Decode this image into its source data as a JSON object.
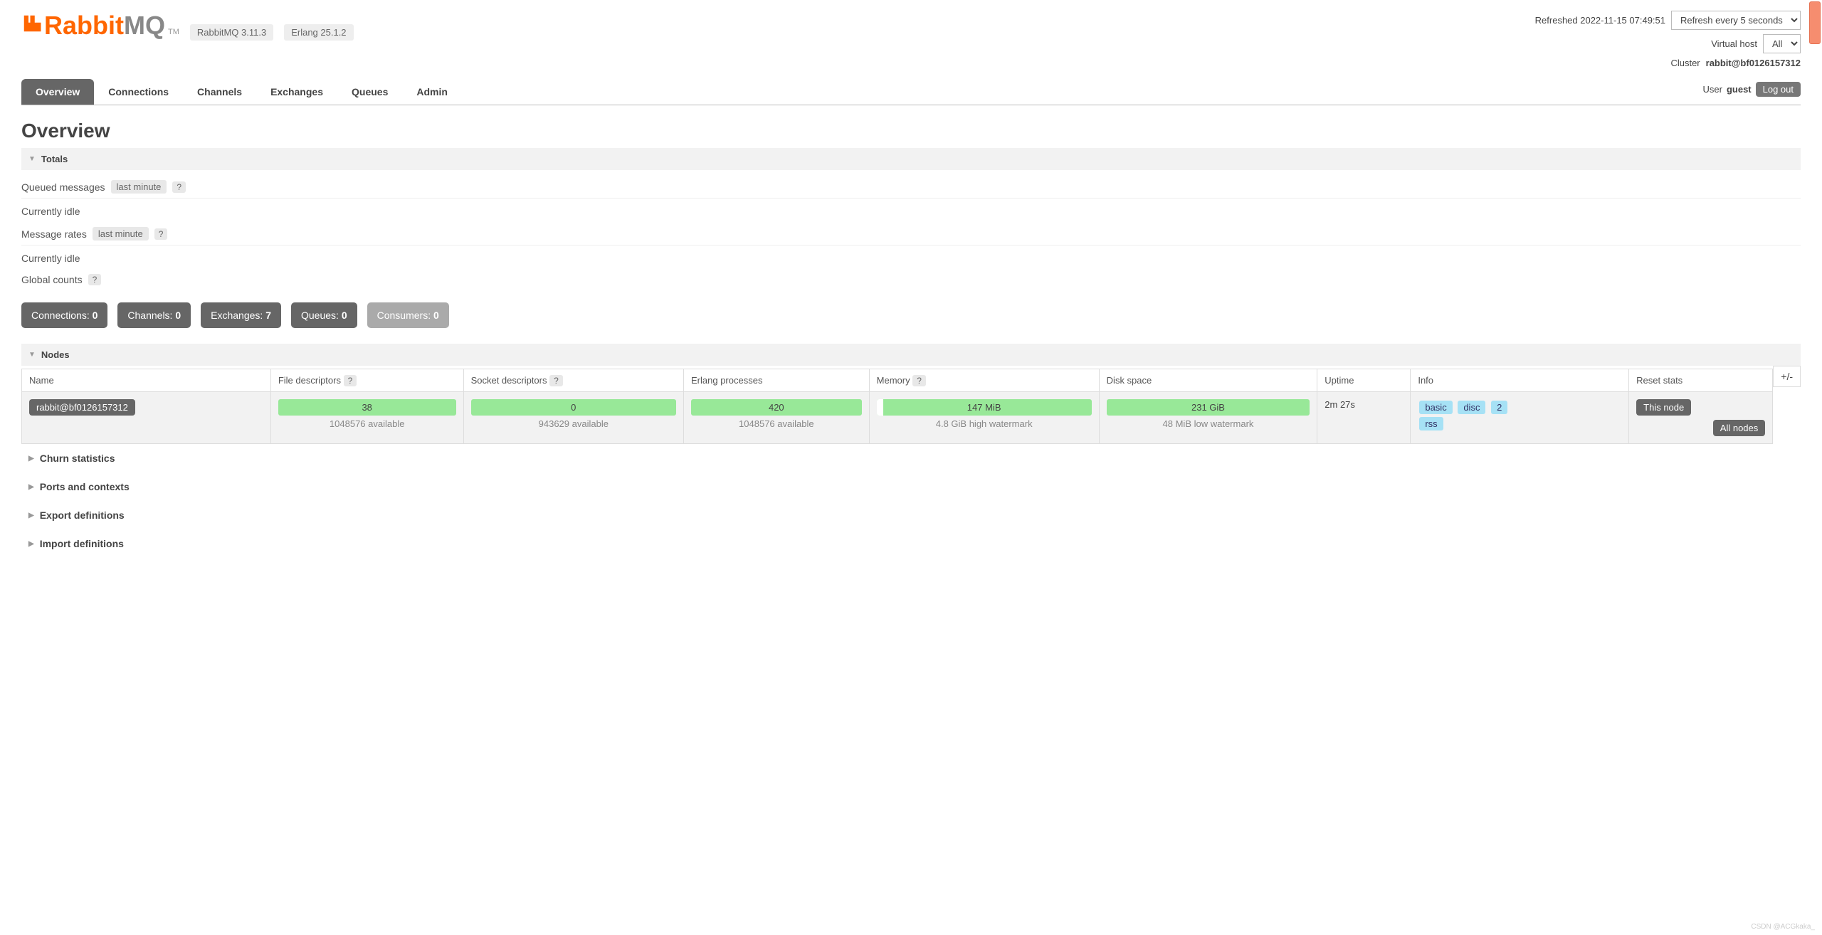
{
  "header": {
    "logo_prefix": "Rabbit",
    "logo_suffix": "MQ",
    "tm": "TM",
    "rabbitmq_version": "RabbitMQ 3.11.3",
    "erlang_version": "Erlang 25.1.2",
    "refreshed_label": "Refreshed 2022-11-15 07:49:51",
    "refresh_option": "Refresh every 5 seconds",
    "vhost_label": "Virtual host",
    "vhost_option": "All",
    "cluster_label": "Cluster ",
    "cluster_value": "rabbit@bf0126157312",
    "user_label": "User ",
    "user_value": "guest",
    "logout": "Log out"
  },
  "tabs": [
    "Overview",
    "Connections",
    "Channels",
    "Exchanges",
    "Queues",
    "Admin"
  ],
  "page_title": "Overview",
  "sections": {
    "totals": "Totals",
    "queued_label": "Queued messages",
    "last_minute": "last minute",
    "idle": "Currently idle",
    "rates_label": "Message rates",
    "global_counts": "Global counts",
    "nodes": "Nodes",
    "churn": "Churn statistics",
    "ports": "Ports and contexts",
    "export": "Export definitions",
    "import": "Import definitions"
  },
  "counts": [
    {
      "label": "Connections:",
      "value": "0"
    },
    {
      "label": "Channels:",
      "value": "0"
    },
    {
      "label": "Exchanges:",
      "value": "7"
    },
    {
      "label": "Queues:",
      "value": "0"
    },
    {
      "label": "Consumers:",
      "value": "0"
    }
  ],
  "nodes_table": {
    "headers": [
      "Name",
      "File descriptors",
      "Socket descriptors",
      "Erlang processes",
      "Memory",
      "Disk space",
      "Uptime",
      "Info",
      "Reset stats"
    ],
    "expand": "+/-",
    "row": {
      "name": "rabbit@bf0126157312",
      "fd": {
        "value": "38",
        "sub": "1048576 available"
      },
      "sd": {
        "value": "0",
        "sub": "943629 available"
      },
      "ep": {
        "value": "420",
        "sub": "1048576 available"
      },
      "mem": {
        "value": "147 MiB",
        "sub": "4.8 GiB high watermark"
      },
      "disk": {
        "value": "231 GiB",
        "sub": "48 MiB low watermark"
      },
      "uptime": "2m 27s",
      "info": [
        "basic",
        "disc",
        "2",
        "rss"
      ],
      "reset_this": "This node",
      "reset_all": "All nodes"
    }
  },
  "watermark": "CSDN @ACGkaka_"
}
